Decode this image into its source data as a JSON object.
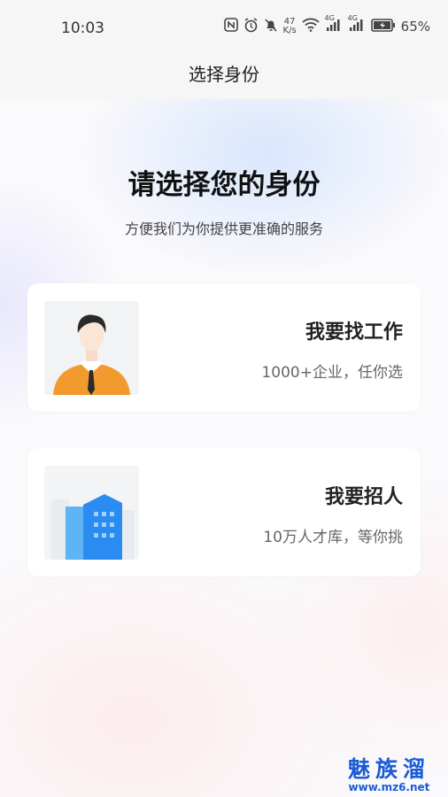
{
  "status_bar": {
    "time": "10:03",
    "network_speed_value": "47",
    "network_speed_unit": "K/s",
    "signal1_label": "4G",
    "signal2_label": "4G",
    "battery": "65%"
  },
  "nav": {
    "title": "选择身份"
  },
  "main": {
    "heading": "请选择您的身份",
    "subheading": "方便我们为你提供更准确的服务"
  },
  "cards": [
    {
      "title": "我要找工作",
      "subtitle": "1000+企业，任你选",
      "icon": "job-seeker-illustration"
    },
    {
      "title": "我要招人",
      "subtitle": "10万人才库，等你挑",
      "icon": "building-illustration"
    }
  ],
  "watermark": {
    "main": "魅族溜",
    "url": "www.mz6.net"
  },
  "colors": {
    "accent_orange": "#f29a2e",
    "accent_blue": "#2a8cf0",
    "watermark_blue": "#1a5bd6"
  }
}
